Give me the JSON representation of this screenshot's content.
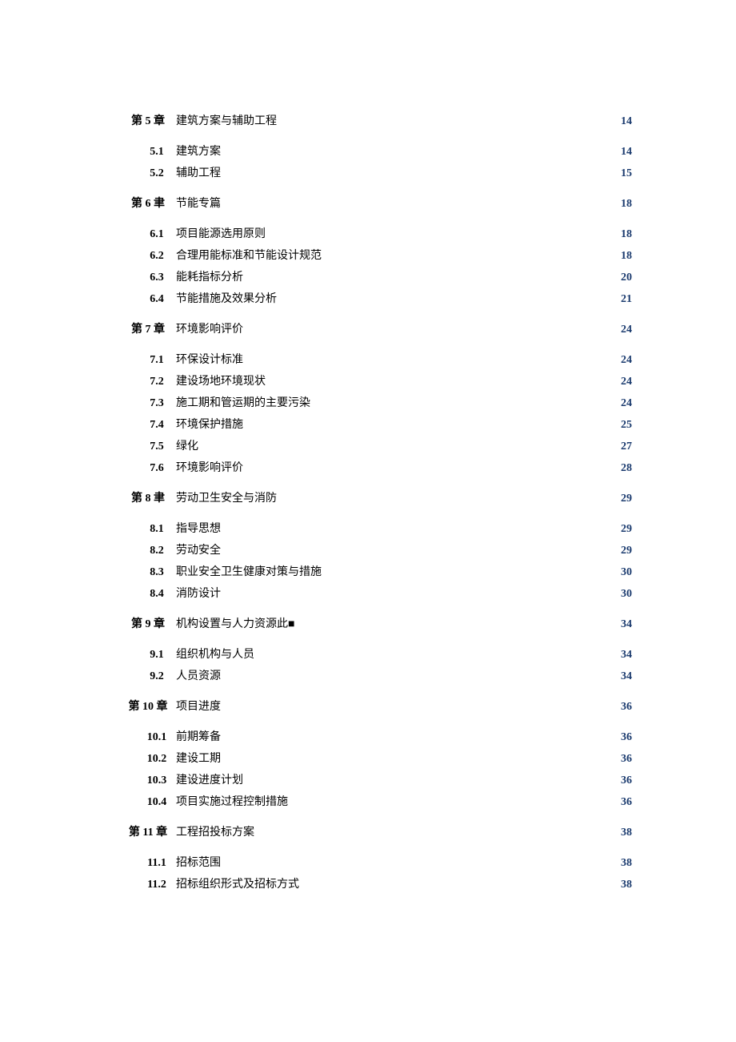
{
  "toc": [
    {
      "level": "chapter",
      "num": "第 5 章",
      "title": "建筑方案与辅助工程",
      "page": "14"
    },
    {
      "level": "section",
      "num": "5.1",
      "title": "建筑方案",
      "page": "14"
    },
    {
      "level": "section",
      "num": "5.2",
      "title": "辅助工程",
      "page": "15"
    },
    {
      "level": "chapter",
      "num": "第 6 聿",
      "title": "节能专篇",
      "page": "18"
    },
    {
      "level": "section",
      "num": "6.1",
      "title": "项目能源选用原则",
      "page": "18"
    },
    {
      "level": "section",
      "num": "6.2",
      "title": "合理用能标准和节能设计规范",
      "page": "18"
    },
    {
      "level": "section",
      "num": "6.3",
      "title": "能耗指标分析",
      "page": "20"
    },
    {
      "level": "section",
      "num": "6.4",
      "title": "节能措施及效果分析",
      "page": "21"
    },
    {
      "level": "chapter",
      "num": "第 7 章",
      "title": "环境影响评价",
      "page": "24"
    },
    {
      "level": "section",
      "num": "7.1",
      "title": "环保设计标准",
      "page": "24"
    },
    {
      "level": "section",
      "num": "7.2",
      "title": "建设场地环境现状",
      "page": "24"
    },
    {
      "level": "section",
      "num": "7.3",
      "title": "施工期和管运期的主要污染",
      "page": "24"
    },
    {
      "level": "section",
      "num": "7.4",
      "title": "环境保护措施",
      "page": "25"
    },
    {
      "level": "section",
      "num": "7.5",
      "title": "绿化",
      "page": "27"
    },
    {
      "level": "section",
      "num": "7.6",
      "title": "环境影响评价",
      "page": "28"
    },
    {
      "level": "chapter",
      "num": "第 8 聿",
      "title": "劳动卫生安全与消防",
      "page": "29"
    },
    {
      "level": "section",
      "num": "8.1",
      "title": "指导思想",
      "page": "29"
    },
    {
      "level": "section",
      "num": "8.2",
      "title": "劳动安全",
      "page": "29"
    },
    {
      "level": "section",
      "num": "8.3",
      "title": "职业安全卫生健康对策与措施",
      "page": "30"
    },
    {
      "level": "section",
      "num": "8.4",
      "title": "消防设计",
      "page": "30"
    },
    {
      "level": "chapter",
      "num": "第 9 章",
      "title": "机构设置与人力资源此■",
      "page": "34"
    },
    {
      "level": "section",
      "num": "9.1",
      "title": "组织机构与人员",
      "page": "34"
    },
    {
      "level": "section",
      "num": "9.2",
      "title": "人员资源",
      "page": "34"
    },
    {
      "level": "chapter",
      "num": "第 10 章",
      "title": "项目进度",
      "page": "36"
    },
    {
      "level": "section",
      "num": "10.1",
      "title": "前期筹备",
      "page": "36"
    },
    {
      "level": "section",
      "num": "10.2",
      "title": "建设工期",
      "page": "36"
    },
    {
      "level": "section",
      "num": "10.3",
      "title": "建设进度计划",
      "page": "36"
    },
    {
      "level": "section",
      "num": "10.4",
      "title": "项目实施过程控制措施",
      "page": "36"
    },
    {
      "level": "chapter",
      "num": "第 11 章",
      "title": "工程招投标方案",
      "page": "38"
    },
    {
      "level": "section",
      "num": "11.1",
      "title": "招标范围",
      "page": "38"
    },
    {
      "level": "section",
      "num": "11.2",
      "title": "招标组织形式及招标方式",
      "page": "38"
    }
  ]
}
